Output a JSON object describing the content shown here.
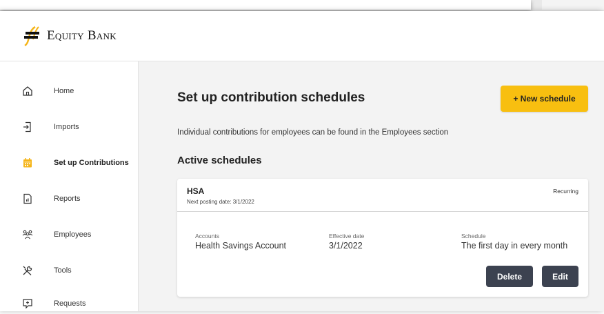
{
  "brand": {
    "name": "Equity Bank",
    "accent": "#f8bf10"
  },
  "sidebar": {
    "items": [
      {
        "label": "Home",
        "icon": "home-icon",
        "active": false
      },
      {
        "label": "Imports",
        "icon": "import-icon",
        "active": false
      },
      {
        "label": "Set up Contributions",
        "icon": "calendar-icon",
        "active": true
      },
      {
        "label": "Reports",
        "icon": "report-icon",
        "active": false
      },
      {
        "label": "Employees",
        "icon": "employees-icon",
        "active": false
      },
      {
        "label": "Tools",
        "icon": "tools-icon",
        "active": false
      },
      {
        "label": "Requests",
        "icon": "requests-icon",
        "active": false
      }
    ]
  },
  "main": {
    "title": "Set up contribution schedules",
    "new_button": "+ New schedule",
    "subtitle": "Individual contributions for employees can be found in the Employees section",
    "section_title": "Active schedules"
  },
  "schedule": {
    "name": "HSA",
    "next_posting": "Next posting date: 3/1/2022",
    "type": "Recurring",
    "accounts_label": "Accounts",
    "accounts_value": "Health Savings Account",
    "effective_label": "Effective date",
    "effective_value": "3/1/2022",
    "schedule_label": "Schedule",
    "schedule_value": "The first day in every month",
    "delete_label": "Delete",
    "edit_label": "Edit"
  }
}
